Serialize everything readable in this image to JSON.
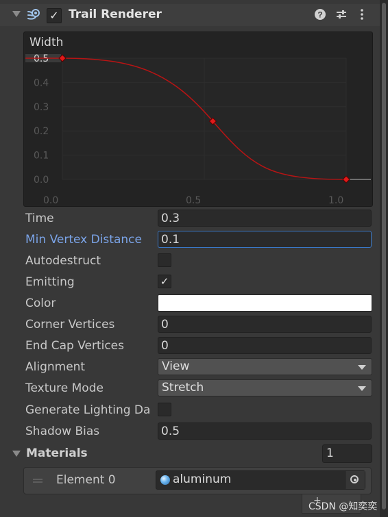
{
  "component": {
    "title": "Trail Renderer",
    "enabled": "✓"
  },
  "width_curve": {
    "label": "Width",
    "y_ticks": [
      "0.5",
      "0.4",
      "0.3",
      "0.2",
      "0.1",
      "0.0"
    ],
    "x_ticks": [
      "0.0",
      "0.5",
      "1.0"
    ],
    "curve_color": "#b81414",
    "keys": [
      {
        "t": 0.0,
        "v": 0.5
      },
      {
        "t": 0.53,
        "v": 0.24
      },
      {
        "t": 1.0,
        "v": 0.0
      }
    ]
  },
  "properties": [
    {
      "label": "Time",
      "type": "field",
      "value": "0.3"
    },
    {
      "label": "Min Vertex Distance",
      "type": "field",
      "value": "0.1",
      "focused": true
    },
    {
      "label": "Autodestruct",
      "type": "checkbox",
      "value": ""
    },
    {
      "label": "Emitting",
      "type": "checkbox",
      "value": "✓"
    },
    {
      "label": "Color",
      "type": "color",
      "value": "#ffffff"
    },
    {
      "label": "Corner Vertices",
      "type": "field",
      "value": "0"
    },
    {
      "label": "End Cap Vertices",
      "type": "field",
      "value": "0"
    },
    {
      "label": "Alignment",
      "type": "dropdown",
      "value": "View"
    },
    {
      "label": "Texture Mode",
      "type": "dropdown",
      "value": "Stretch"
    },
    {
      "label": "Generate Lighting Da",
      "type": "checkbox",
      "value": ""
    },
    {
      "label": "Shadow Bias",
      "type": "field",
      "value": "0.5"
    }
  ],
  "materials": {
    "label": "Materials",
    "count": "1",
    "elements": [
      {
        "label": "Element 0",
        "value": "aluminum"
      }
    ]
  },
  "watermark": "CSDN @知奕奕"
}
